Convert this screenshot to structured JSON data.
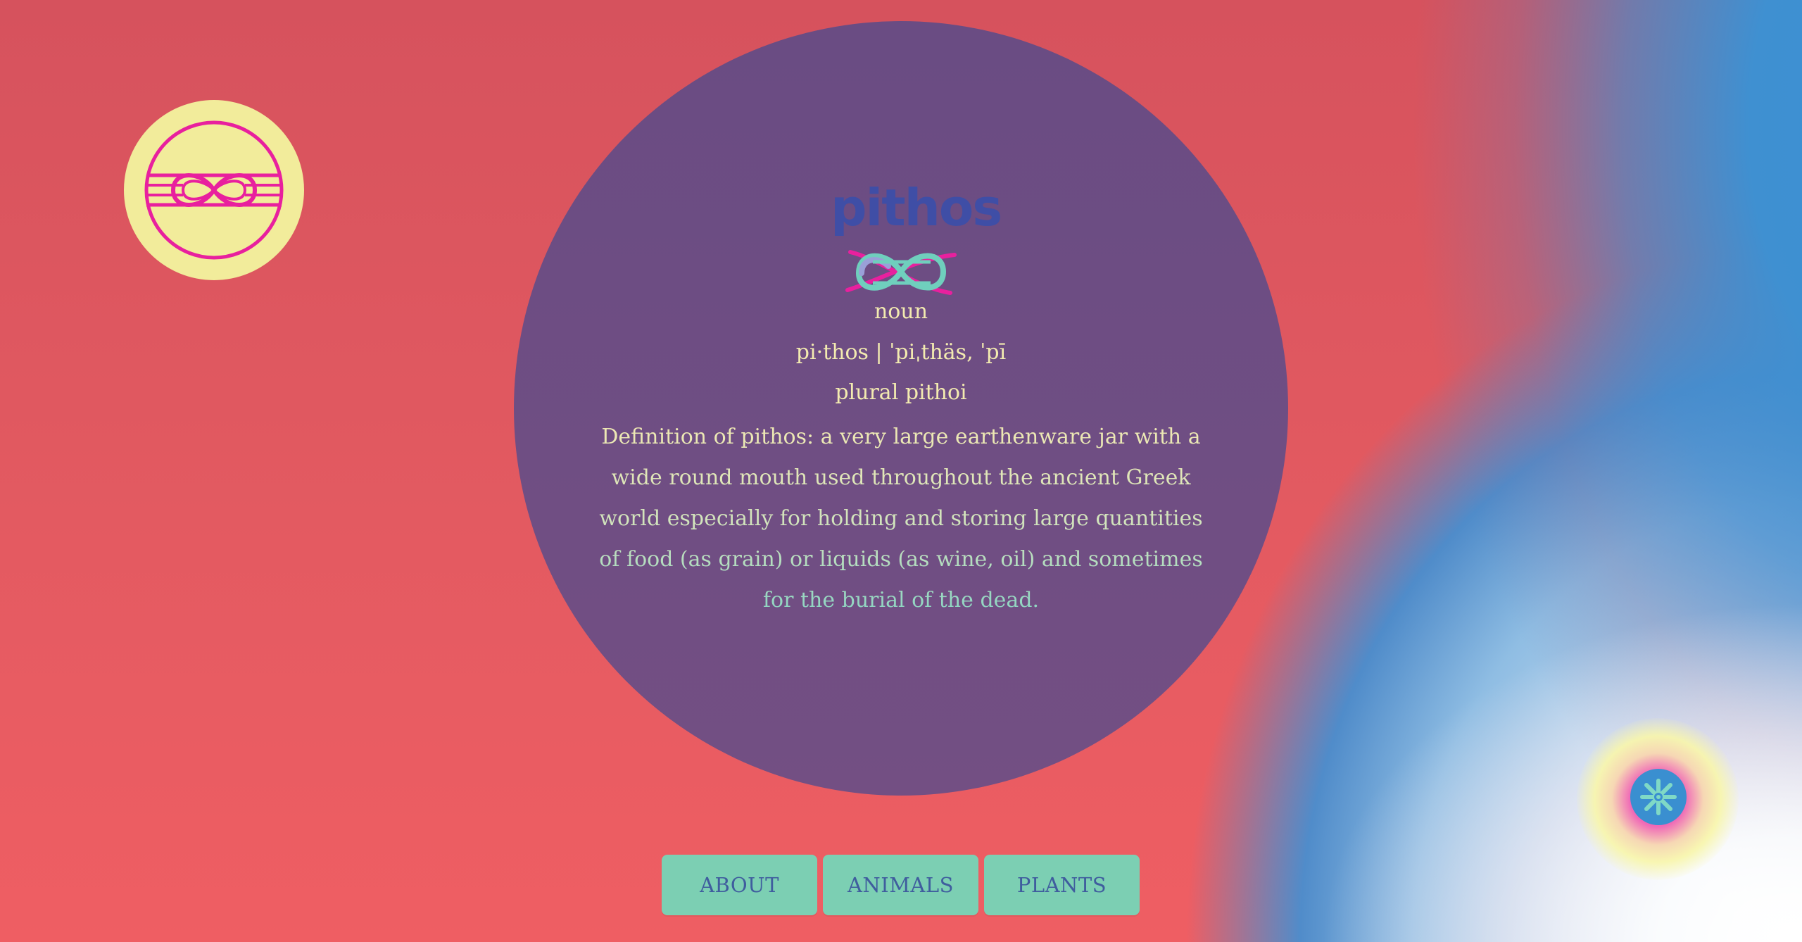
{
  "logo": {
    "icon": "knot-icon",
    "badge_color": "#f2ec9b",
    "icon_color": "#e8209e"
  },
  "entry": {
    "wordmark": "pithos",
    "part_of_speech": "noun",
    "pronunciation": "pi·thos | ˈpiˌthäs, ˈpī",
    "plural": "plural pithoi",
    "definition": "Definition of pithos: a very large earthenware jar with a wide round mouth used throughout the ancient Greek world especially for holding and storing large quantities of food (as grain) or liquids (as wine, oil) and sometimes for the burial of the dead."
  },
  "nav": {
    "items": [
      {
        "label": "ABOUT"
      },
      {
        "label": "ANIMALS"
      },
      {
        "label": "PLANTS"
      }
    ]
  },
  "fab": {
    "icon": "flower-icon"
  },
  "colors": {
    "background_red": "#e35a61",
    "disc": "#6e4d83",
    "text_cream": "#f3ebb0",
    "button_teal": "#7ccfb3",
    "button_text": "#3f5d9e",
    "accent_blue": "#3a90d3",
    "accent_pink": "#ee2ea0"
  }
}
